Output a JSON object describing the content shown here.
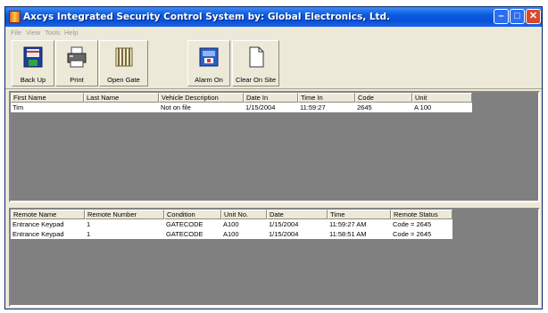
{
  "window": {
    "title": "Axcys Integrated Security Control System by:  Global Electronics, Ltd."
  },
  "menu": [
    "File",
    "View",
    "Tools",
    "Help"
  ],
  "toolbar": [
    {
      "label": "Back Up",
      "icon": "floppy-disk-icon"
    },
    {
      "label": "Print",
      "icon": "printer-icon"
    },
    {
      "label": "Open Gate",
      "icon": "gate-icon"
    },
    {
      "label": "Alarm On",
      "icon": "alarm-icon"
    },
    {
      "label": "Clear On Site",
      "icon": "blank-document-icon"
    }
  ],
  "onsite_table": {
    "columns": [
      "First Name",
      "Last Name",
      "Vehicle Description",
      "Date In",
      "Time In",
      "Code",
      "Unit"
    ],
    "rows": [
      [
        "Tim",
        "",
        "Not on file",
        "1/15/2004",
        "11:59:27",
        "2645",
        "A  100"
      ]
    ]
  },
  "remote_table": {
    "columns": [
      "Remote Name",
      "Remote Number",
      "Condition",
      "Unit No.",
      "Date",
      "Time",
      "Remote Status"
    ],
    "rows": [
      [
        "Entrance Keypad",
        "1",
        "GATECODE",
        "A100",
        "1/15/2004",
        "11:59:27 AM",
        "Code = 2645"
      ],
      [
        "Entrance Keypad",
        "1",
        "GATECODE",
        "A100",
        "1/15/2004",
        "11:58:51 AM",
        "Code = 2645"
      ]
    ]
  },
  "colors": {
    "titlebar": "#0a5ae0",
    "workspace": "#808080",
    "chrome": "#ece9d8"
  }
}
